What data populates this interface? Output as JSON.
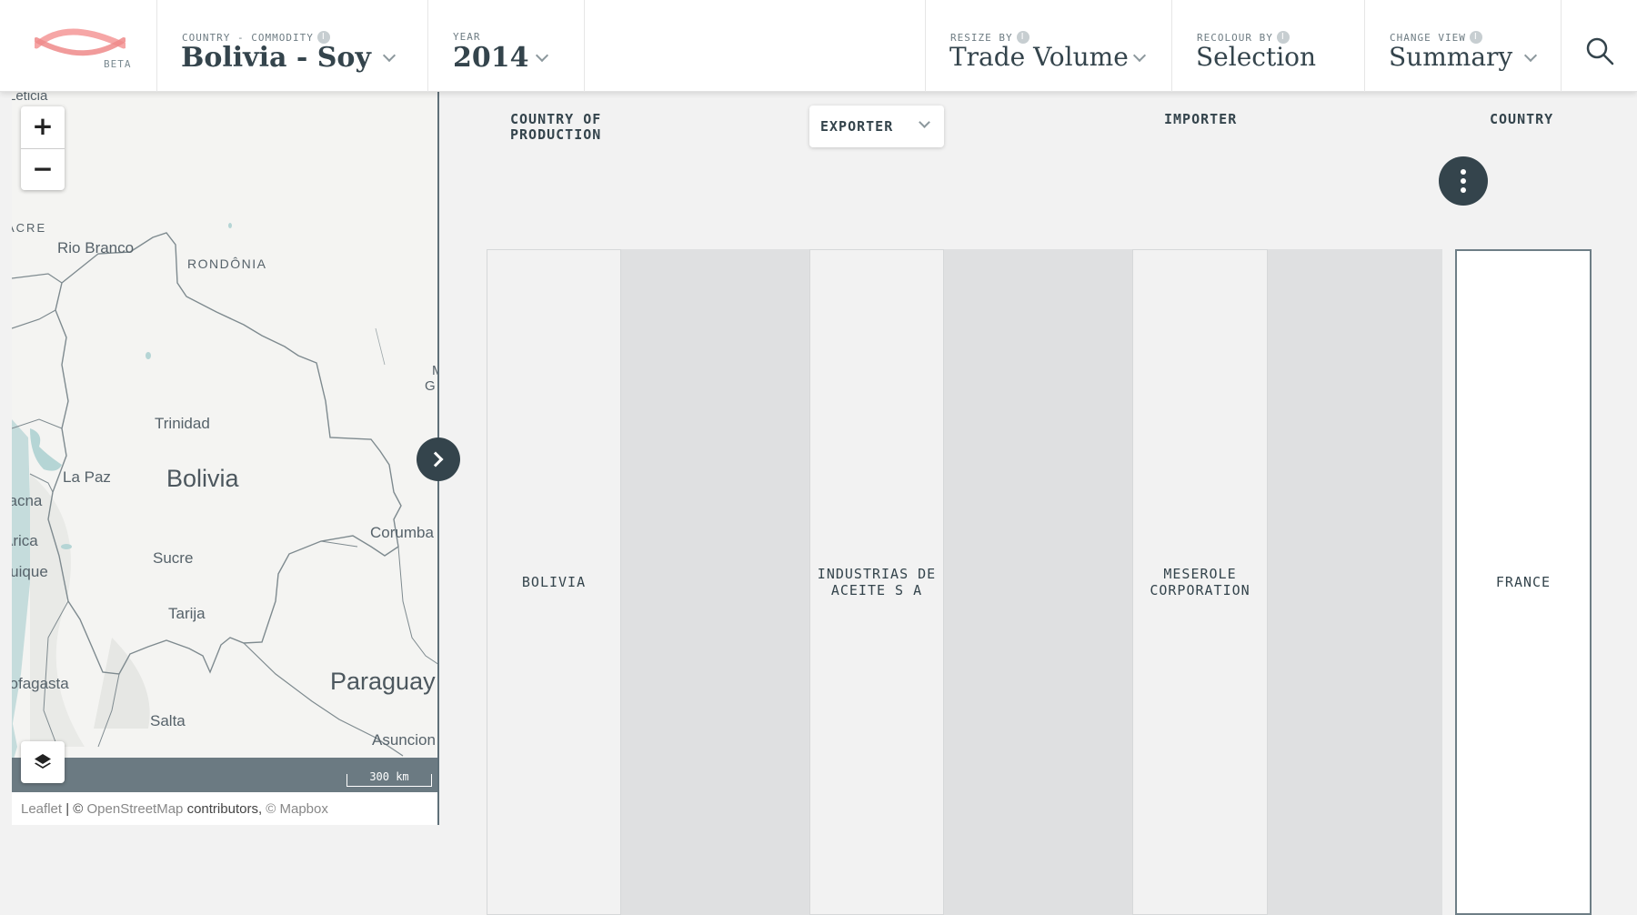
{
  "header": {
    "logo_badge": "BETA",
    "country_commodity": {
      "label": "COUNTRY - COMMODITY",
      "value": "Bolivia - Soy"
    },
    "year": {
      "label": "YEAR",
      "value": "2014"
    },
    "resize_by": {
      "label": "RESIZE BY",
      "value": "Trade Volume"
    },
    "recolour_by": {
      "label": "RECOLOUR BY",
      "value": "Selection"
    },
    "change_view": {
      "label": "CHANGE VIEW",
      "value": "Summary"
    },
    "info_glyph": "i"
  },
  "map": {
    "zoom_in": "+",
    "zoom_out": "−",
    "labels": {
      "leticia": "Leticia",
      "acre": "ACRE",
      "rio_branco": "Rio Branco",
      "rondonia": "RONDÔNIA",
      "trinidad": "Trinidad",
      "la_paz": "La Paz",
      "bolivia": "Bolivia",
      "tacna": "Tacna",
      "arica": "Arica",
      "iquique": "Iquique",
      "sucre": "Sucre",
      "corumba": "Corumba",
      "tarija": "Tarija",
      "antofagasta": "Antofagasta",
      "paraguay": "Paraguay",
      "salta": "Salta",
      "asuncion": "Asuncion",
      "mg": "M",
      "gr": "G"
    },
    "scale": "300 km",
    "attribution": {
      "leaflet": "Leaflet",
      "sep": " | © ",
      "osm": "OpenStreetMap",
      "contrib": " contributors, ",
      "mapbox": "© Mapbox"
    }
  },
  "sankey": {
    "columns": {
      "production": "COUNTRY OF\nPRODUCTION",
      "exporter": "EXPORTER",
      "importer": "IMPORTER",
      "country": "COUNTRY"
    },
    "nodes": {
      "production": "BOLIVIA",
      "exporter": "INDUSTRIAS DE ACEITE S A",
      "importer": "MESEROLE CORPORATION",
      "country": "FRANCE"
    }
  }
}
